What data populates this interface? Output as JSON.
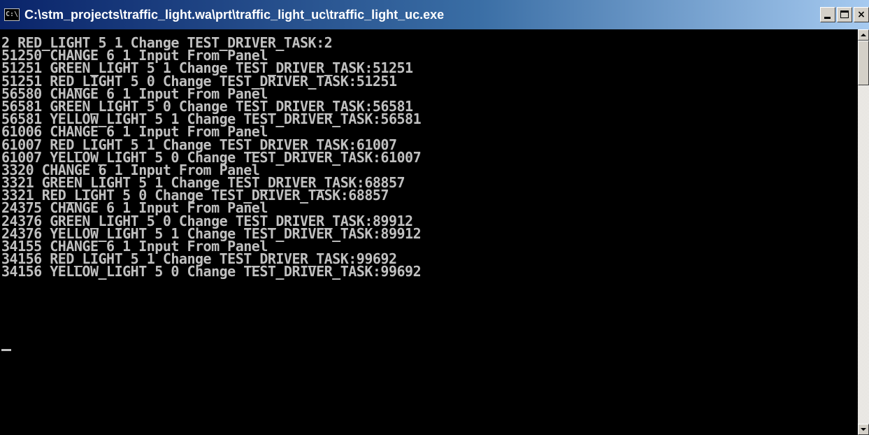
{
  "window": {
    "title": "C:\\stm_projects\\traffic_light.wa\\prt\\traffic_light_uc\\traffic_light_uc.exe",
    "icon": "console-app-icon",
    "icon_text": "C:\\",
    "buttons": {
      "minimize": "minimize",
      "maximize": "maximize",
      "close": "×"
    }
  },
  "console": {
    "lines": [
      "2 RED_LIGHT 5 1 Change TEST_DRIVER_TASK:2",
      "51250 CHANGE 6 1 Input From Panel",
      "51251 GREEN_LIGHT 5 1 Change TEST_DRIVER_TASK:51251",
      "51251 RED_LIGHT 5 0 Change TEST_DRIVER_TASK:51251",
      "56580 CHANGE 6 1 Input From Panel",
      "56581 GREEN_LIGHT 5 0 Change TEST_DRIVER_TASK:56581",
      "56581 YELLOW_LIGHT 5 1 Change TEST_DRIVER_TASK:56581",
      "61006 CHANGE 6 1 Input From Panel",
      "61007 RED_LIGHT 5 1 Change TEST_DRIVER_TASK:61007",
      "61007 YELLOW_LIGHT 5 0 Change TEST_DRIVER_TASK:61007",
      "3320 CHANGE 6 1 Input From Panel",
      "3321 GREEN_LIGHT 5 1 Change TEST_DRIVER_TASK:68857",
      "3321 RED_LIGHT 5 0 Change TEST_DRIVER_TASK:68857",
      "24375 CHANGE 6 1 Input From Panel",
      "24376 GREEN_LIGHT 5 0 Change TEST_DRIVER_TASK:89912",
      "24376 YELLOW_LIGHT 5 1 Change TEST_DRIVER_TASK:89912",
      "34155 CHANGE 6 1 Input From Panel",
      "34156 RED_LIGHT 5 1 Change TEST_DRIVER_TASK:99692",
      "34156 YELLOW_LIGHT 5 0 Change TEST_DRIVER_TASK:99692"
    ]
  },
  "colors": {
    "console_bg": "#000000",
    "console_fg": "#c0c0c0",
    "titlebar_start": "#0a246a",
    "titlebar_end": "#a6caf0"
  }
}
